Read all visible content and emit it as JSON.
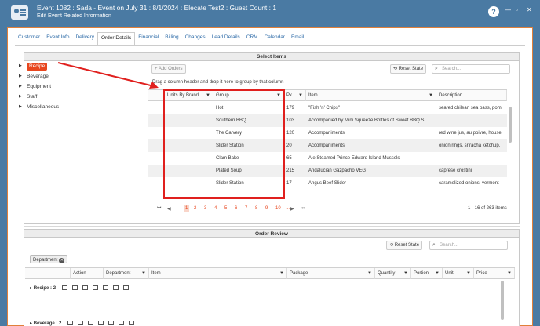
{
  "window": {
    "title": "Event 1082 : Sada - Event on July 31 : 8/1/2024 : Elecate Test2 : Guest Count : 1",
    "subtitle": "Edit Event Related Information",
    "help": "?",
    "min": "—",
    "max": "▫",
    "close": "✕"
  },
  "tabs": [
    "Customer",
    "Event Info",
    "Delivery",
    "Order Details",
    "Financial",
    "Billing",
    "Changes",
    "Lead Details",
    "CRM",
    "Calendar",
    "Email"
  ],
  "active_tab": "Order Details",
  "select_items": {
    "title": "Select Items",
    "tree": [
      "Recipe",
      "Beverage",
      "Equipment",
      "Staff",
      "Miscellaneous"
    ],
    "add_orders": "Add Orders",
    "reset_state": "Reset State",
    "search_placeholder": "Search...",
    "group_hint": "Drag a column header and drop it here to group by that column",
    "columns": [
      "Units By Brand",
      "Group",
      "Pk",
      "Item",
      "Description"
    ],
    "rows": [
      {
        "units": "",
        "group": "Hot",
        "pk": "179",
        "item": "\"Fish 'n' Chips\"",
        "desc": "seared chilean sea bass, pom"
      },
      {
        "units": "",
        "group": "Southern BBQ",
        "pk": "103",
        "item": "Accompanied by Mini Squeeze Bottles of Sweet BBQ S",
        "desc": ""
      },
      {
        "units": "",
        "group": "The Carvery",
        "pk": "120",
        "item": "Accompaniments",
        "desc": "red wine jus, au poivre, house"
      },
      {
        "units": "",
        "group": "Slider Station",
        "pk": "20",
        "item": "Accompaniments",
        "desc": "onion rings, sriracha ketchup,"
      },
      {
        "units": "",
        "group": "Clam Bake",
        "pk": "65",
        "item": "Ale Steamed Prince Edward Island Mussels",
        "desc": ""
      },
      {
        "units": "",
        "group": "Plated Soup",
        "pk": "215",
        "item": "Andalucian Gazpacho VEG",
        "desc": "caprese crostini"
      },
      {
        "units": "",
        "group": "Slider Station",
        "pk": "17",
        "item": "Angus Beef Slider",
        "desc": "caramelized onions, vermont"
      }
    ],
    "pager": {
      "first": "⏮",
      "prev": "◀",
      "pages": [
        "1",
        "2",
        "3",
        "4",
        "5",
        "6",
        "7",
        "8",
        "9",
        "10",
        "..."
      ],
      "next": "▶",
      "last": "⏭",
      "summary": "1 - 16 of 263 items"
    }
  },
  "order_review": {
    "title": "Order Review",
    "reset_state": "Reset State",
    "search_placeholder": "Search...",
    "chip": "Department",
    "columns": [
      "Action",
      "Department",
      "Item",
      "Package",
      "Quantity",
      "Portion",
      "Unit",
      "Price"
    ],
    "groups": [
      "Recipe : 2",
      "Beverage : 2"
    ]
  }
}
